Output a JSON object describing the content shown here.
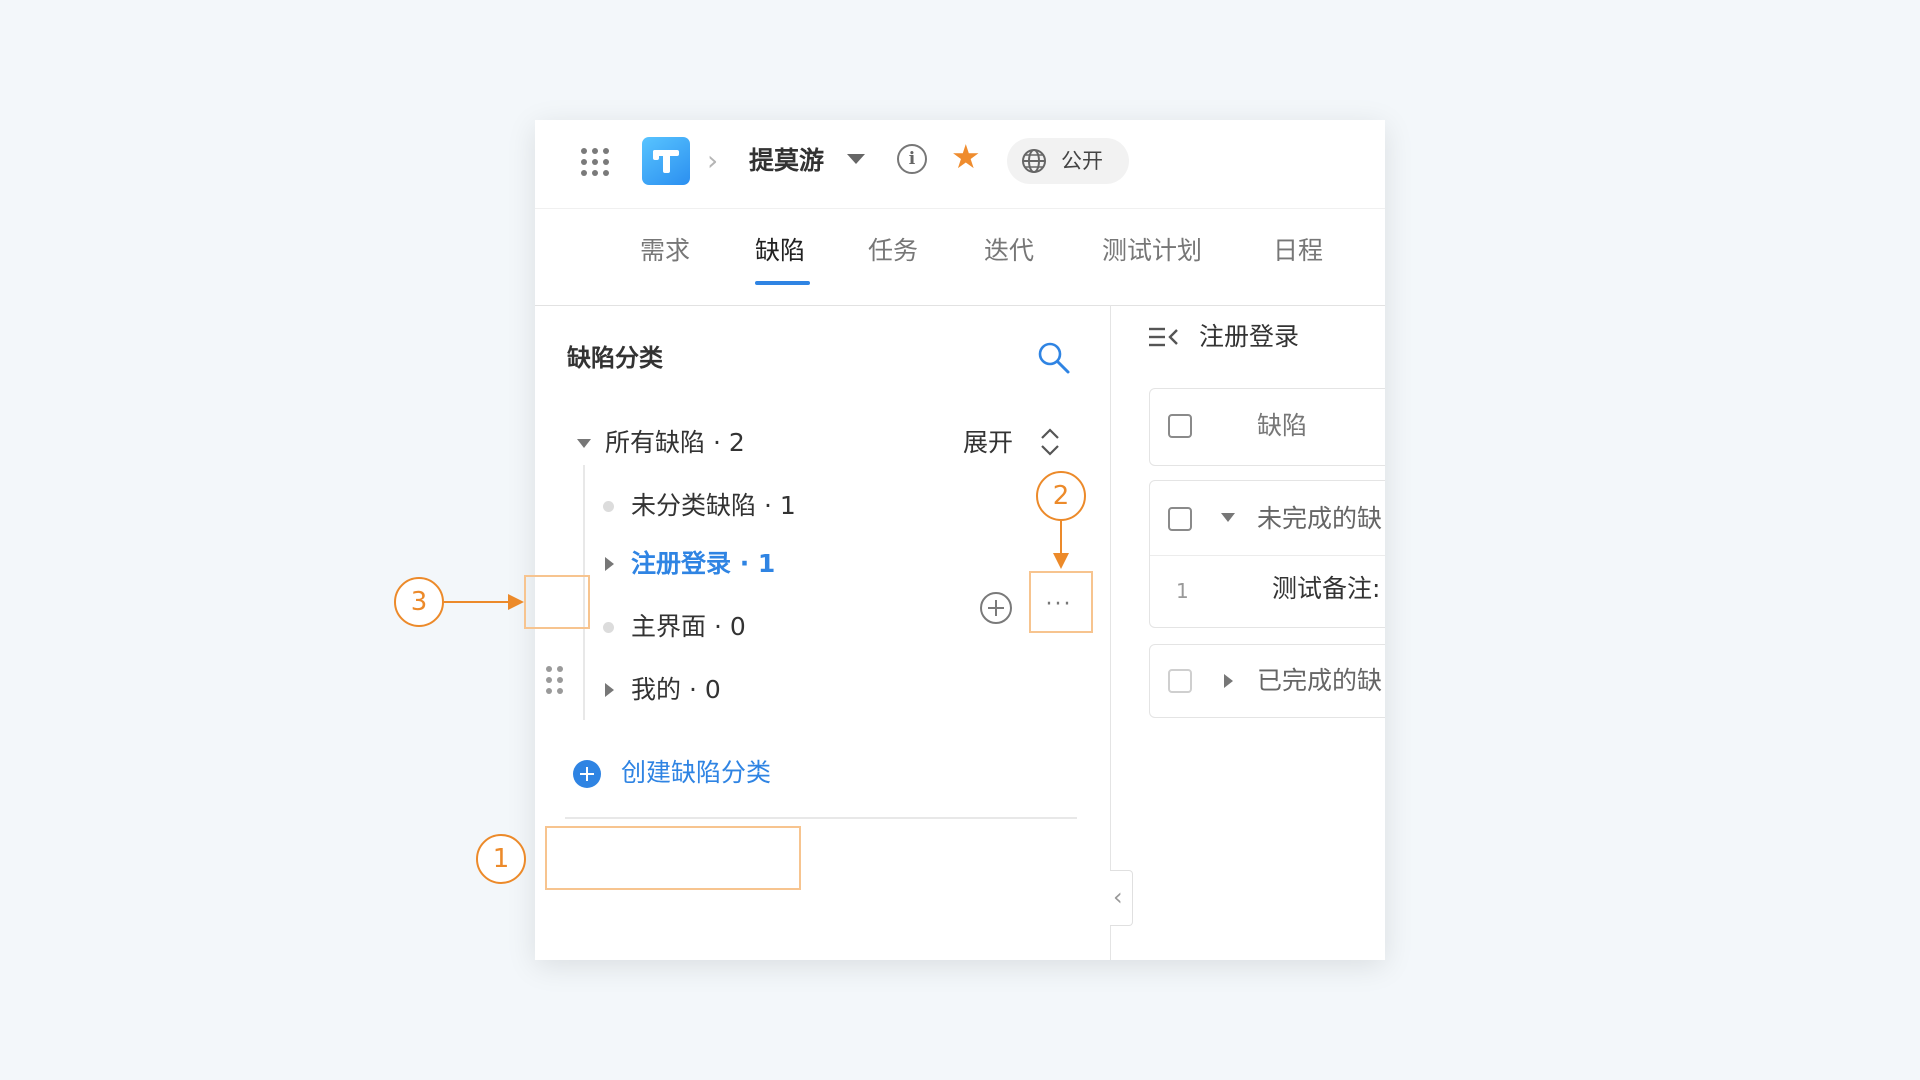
{
  "header": {
    "project_name": "提莫游",
    "info_glyph": "i",
    "public_label": "公开"
  },
  "tabs": [
    {
      "label": "需求",
      "active": false
    },
    {
      "label": "缺陷",
      "active": true
    },
    {
      "label": "任务",
      "active": false
    },
    {
      "label": "迭代",
      "active": false
    },
    {
      "label": "测试计划",
      "active": false
    },
    {
      "label": "日程",
      "active": false
    }
  ],
  "sidebar": {
    "title": "缺陷分类",
    "expand_label": "展开",
    "root": {
      "label": "所有缺陷 · 2"
    },
    "items": [
      {
        "label": "未分类缺陷 · 1",
        "type": "leaf"
      },
      {
        "label": "注册登录 · 1",
        "type": "branch",
        "active": true
      },
      {
        "label": "主界面 · 0",
        "type": "leaf"
      },
      {
        "label": "我的 · 0",
        "type": "branch"
      }
    ],
    "more_label": "···",
    "create_label": "创建缺陷分类"
  },
  "panel": {
    "title": "注册登录",
    "header_col": "缺陷",
    "groups": [
      {
        "label": "未完成的缺",
        "expanded": true,
        "rows": [
          {
            "index": "1",
            "title": "测试备注:"
          }
        ]
      },
      {
        "label": "已完成的缺",
        "expanded": false
      }
    ]
  },
  "annotations": [
    "1",
    "2",
    "3"
  ],
  "colors": {
    "accent": "#2f84e3",
    "callout": "#ec8a2a",
    "highlight": "#f7c48f",
    "star": "#ef8c2e"
  }
}
